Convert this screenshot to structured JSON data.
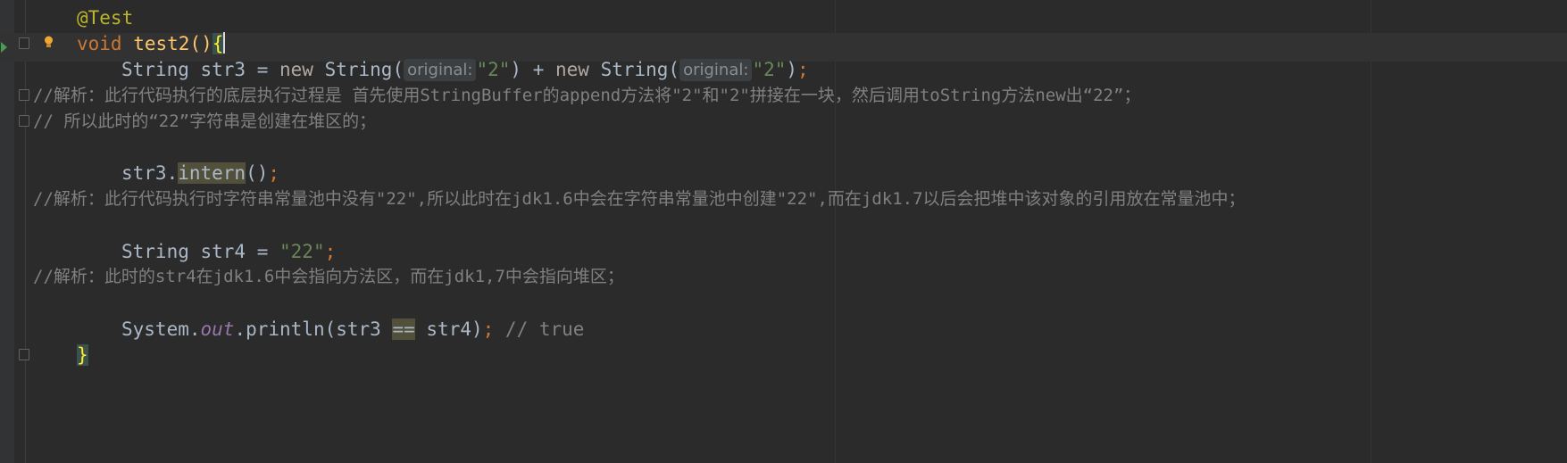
{
  "editor": {
    "lines": {
      "annotation": "@Test",
      "void_kw": "void",
      "method_name": "test2",
      "parens": "()",
      "open_brace": "{",
      "str3_type": "String str3 = ",
      "new_kw_1": "new",
      "string_call_1": " String(",
      "hint_1": "original:",
      "str_arg_1": "\"2\"",
      "plus": ") + ",
      "new_kw_2": "new",
      "string_call_2": " String(",
      "hint_2": "original:",
      "str_arg_2": "\"2\"",
      "close_1": ")",
      "semi_1": ";",
      "comment_1": "//解析：此行代码执行的底层执行过程是 首先使用StringBuffer的append方法将\"2\"和\"2\"拼接在一块，然后调用toString方法new出“22”；",
      "comment_2": "// 所以此时的“22”字符串是创建在堆区的；",
      "intern_prefix": "str3.",
      "intern_call": "intern",
      "intern_suffix": "()",
      "semi_2": ";",
      "comment_3": "//解析：此行代码执行时字符串常量池中没有\"22\",所以此时在jdk1.6中会在字符串常量池中创建\"22\",而在jdk1.7以后会把堆中该对象的引用放在常量池中；",
      "str4_decl": "String str4 = ",
      "str4_value": "\"22\"",
      "semi_3": ";",
      "comment_4": "//解析：此时的str4在jdk1.6中会指向方法区，而在jdk1,7中会指向堆区；",
      "println_prefix": "System.",
      "println_field": "out",
      "println_call": ".println(str3 ",
      "eq_op": "==",
      "println_arg": " str4)",
      "semi_4": ";",
      "trailing_comment": " // true",
      "close_brace": "}"
    }
  },
  "icons": {
    "run": "run-gutter-icon",
    "intention": "lightbulb-icon",
    "fold": "fold-icon"
  },
  "colors": {
    "background": "#2b2b2b",
    "keyword": "#cc7832",
    "string": "#6a8759",
    "comment": "#808080",
    "method": "#ffc66d",
    "annotation": "#bbb529"
  }
}
